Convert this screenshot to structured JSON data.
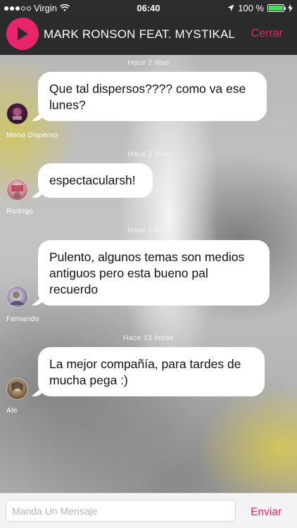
{
  "status_bar": {
    "carrier": "Virgin",
    "time": "06:40",
    "battery": "100 %",
    "icons": [
      "signal-dots-icon",
      "wifi-icon",
      "location-arrow-icon",
      "battery-icon",
      "charging-bolt-icon"
    ]
  },
  "header": {
    "track_title": "MARK RONSON FEAT. MYSTIKAL - FEEL RIGHT",
    "close_label": "Cerrar",
    "play_icon": "play-icon"
  },
  "messages": [
    {
      "timestamp": "Hace 2 días",
      "text": "Que tal dispersos???? como va ese lunes?",
      "author": "Mono Disperso"
    },
    {
      "timestamp": "Hace 2 días",
      "text": "espectacularsh!",
      "author": "Rodrigo"
    },
    {
      "timestamp": "Hace 2 días",
      "text": "Pulento, algunos temas son medios antiguos pero esta bueno pal recuerdo",
      "author": "Fernando"
    },
    {
      "timestamp": "Hace 13 horas",
      "text": "La mejor compañía, para tardes de mucha pega :)",
      "author": "Ale"
    }
  ],
  "composer": {
    "placeholder": "Manda Un Mensaje",
    "value": "",
    "send_label": "Enviar"
  },
  "colors": {
    "accent": "#e8246d",
    "header_bg": "#2b2b2b",
    "battery_fill": "#4cd964"
  }
}
